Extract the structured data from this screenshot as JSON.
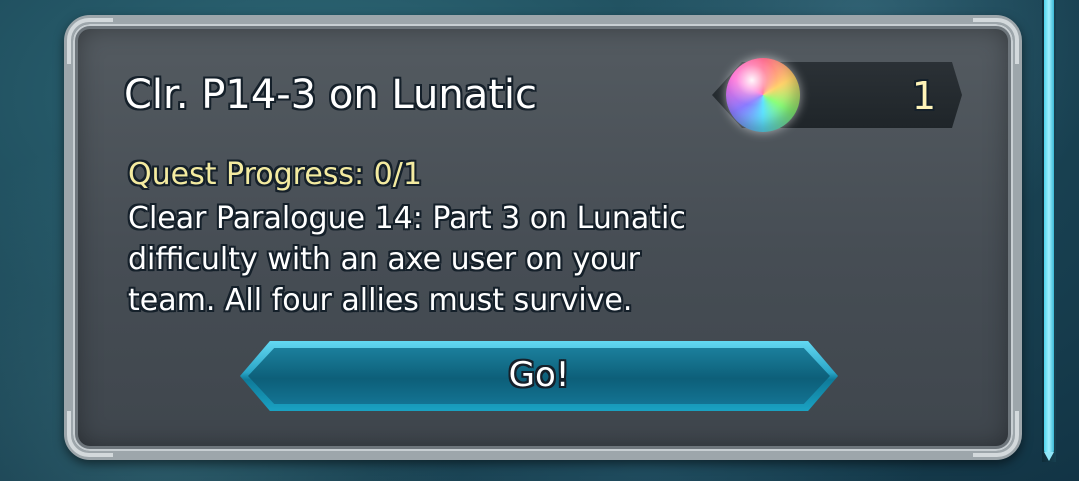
{
  "quest": {
    "title": "Clr. P14-3 on Lunatic",
    "progress": "Quest Progress: 0/1",
    "description": "Clear Paralogue 14: Part 3 on Lunatic\ndifficulty with an axe user on your\nteam. All four allies must survive.",
    "reward": {
      "icon": "orb-icon",
      "count": "1"
    },
    "go_label": "Go!"
  },
  "colors": {
    "progress_text": "#f4eba0",
    "button_accent": "#2aa5c6",
    "scrollbar": "#4fd4ec"
  }
}
